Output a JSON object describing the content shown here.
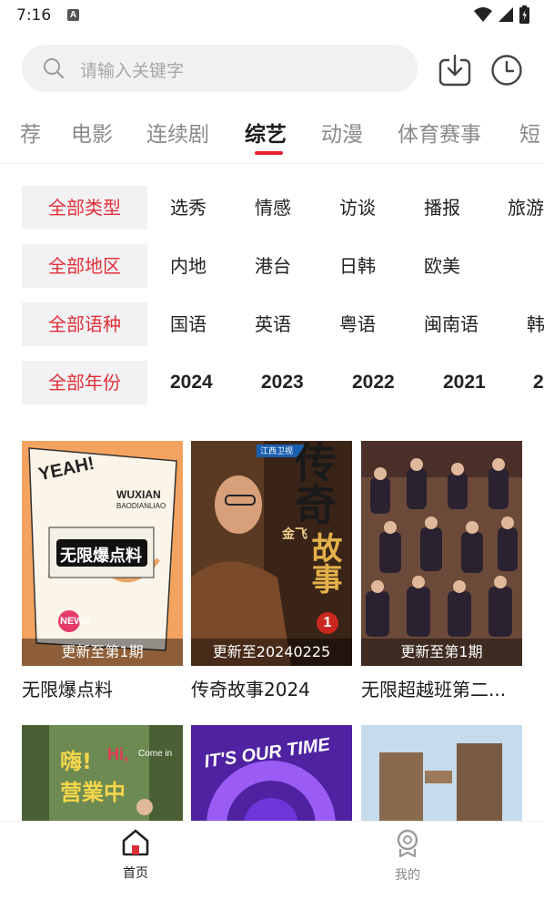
{
  "status_bar": {
    "time": "7:16",
    "notification_icon": "A"
  },
  "search": {
    "placeholder": "请输入关键字"
  },
  "category_tabs": [
    "荐",
    "电影",
    "连续剧",
    "综艺",
    "动漫",
    "体育赛事",
    "短"
  ],
  "active_tab": "综艺",
  "filters": {
    "type": {
      "selected": "全部类型",
      "options": [
        "选秀",
        "情感",
        "访谈",
        "播报",
        "旅游"
      ]
    },
    "region": {
      "selected": "全部地区",
      "options": [
        "内地",
        "港台",
        "日韩",
        "欧美"
      ]
    },
    "language": {
      "selected": "全部语种",
      "options": [
        "国语",
        "英语",
        "粤语",
        "闽南语",
        "韩"
      ]
    },
    "year": {
      "selected": "全部年份",
      "options": [
        "2024",
        "2023",
        "2022",
        "2021",
        "2"
      ]
    }
  },
  "shows": [
    {
      "title": "无限爆点料",
      "update": "更新至第1期",
      "poster_text": [
        "YEAH!",
        "WUXIAN",
        "BAODIANLIAO",
        "无限爆点料",
        "NEWS"
      ]
    },
    {
      "title": "传奇故事2024",
      "update": "更新至20240225",
      "poster_text": [
        "传奇",
        "故事",
        "金飞",
        "1",
        "江西卫视"
      ]
    },
    {
      "title": "无限超越班第二...",
      "update": "更新至第1期",
      "poster_text": []
    },
    {
      "title": "",
      "update": "",
      "poster_text": [
        "嗨!",
        "Hi,",
        "Come in",
        "营業中"
      ]
    },
    {
      "title": "",
      "update": "",
      "poster_text": [
        "IT'S OUR TIME"
      ]
    },
    {
      "title": "",
      "update": "",
      "poster_text": []
    }
  ],
  "bottom_nav": [
    {
      "label": "首页",
      "icon": "home-icon",
      "active": true
    },
    {
      "label": "我的",
      "icon": "profile-icon",
      "active": false
    }
  ],
  "colors": {
    "accent": "#e23039",
    "inactive": "#8a8a8a",
    "filter_bg": "#f2f2f4"
  }
}
